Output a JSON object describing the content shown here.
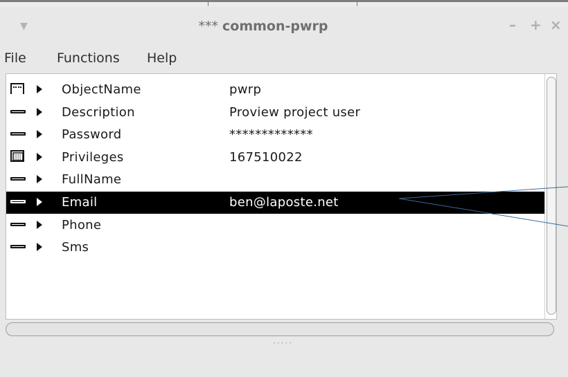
{
  "window": {
    "title_stars": "***",
    "title_name": "common-pwrp",
    "menu_glyph": "▼",
    "minimize_label": "–",
    "maximize_label": "+",
    "close_label": "×"
  },
  "menubar": {
    "items": [
      "File",
      "Functions",
      "Help"
    ]
  },
  "attributes": [
    {
      "icon": "object-icon",
      "name": "ObjectName",
      "value": "pwrp"
    },
    {
      "icon": "attribute-icon",
      "name": "Description",
      "value": "Proview project user"
    },
    {
      "icon": "attribute-icon",
      "name": "Password",
      "value": "*************"
    },
    {
      "icon": "array-icon",
      "name": "Privileges",
      "value": "167510022"
    },
    {
      "icon": "attribute-icon",
      "name": "FullName",
      "value": ""
    },
    {
      "icon": "attribute-icon",
      "name": "Email",
      "value": "ben@laposte.net",
      "selected": true
    },
    {
      "icon": "attribute-icon",
      "name": "Phone",
      "value": ""
    },
    {
      "icon": "attribute-icon",
      "name": "Sms",
      "value": ""
    }
  ],
  "resize_grip": "·····",
  "colors": {
    "selection_bg": "#000000",
    "selection_fg": "#ffffff",
    "panel_bg": "#ffffff",
    "window_bg": "#e8e8e8",
    "pointer_line": "#3a6a9a"
  }
}
